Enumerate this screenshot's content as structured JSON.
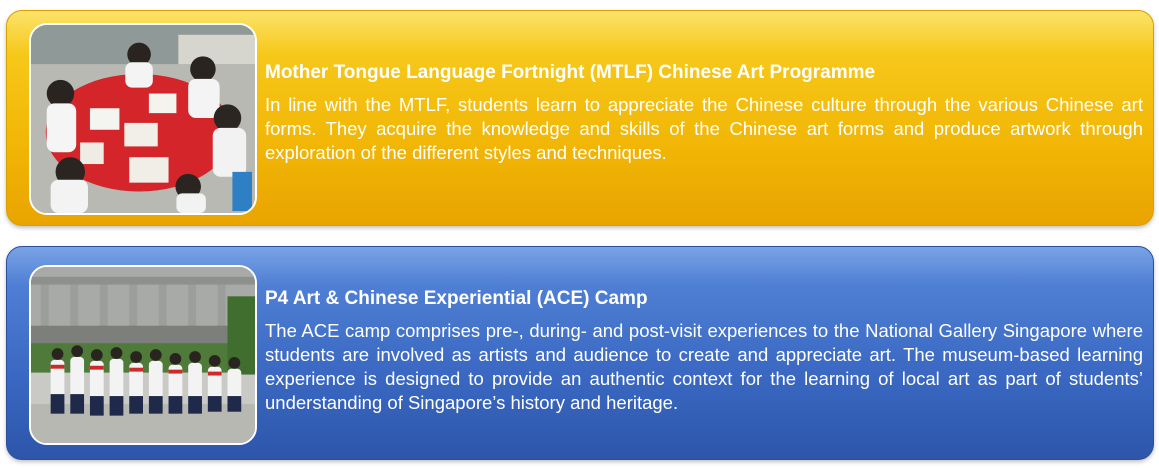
{
  "colors": {
    "card1_bg": "#f2b706",
    "card2_bg": "#3a68c2",
    "text": "#ffffff"
  },
  "programmes": [
    {
      "title": "Mother Tongue Language Fortnight (MTLF) Chinese Art Programme",
      "description": "In line with the MTLF, students learn to appreciate the Chinese culture through the various Chinese art forms. They acquire the knowledge and skills of the Chinese art forms and produce artwork through exploration of the different styles and techniques.",
      "photo": "students-painting-at-table-photo"
    },
    {
      "title": "P4 Art & Chinese Experiential (ACE) Camp",
      "description": "The ACE camp comprises pre-, during- and post-visit experiences to the National Gallery Singapore where students are involved as artists and audience to create and appreciate art. The museum-based learning experience is designed to provide an authentic context for the learning of local art as part of students’ understanding of Singapore’s history and heritage.",
      "photo": "students-group-at-national-gallery-photo"
    }
  ]
}
